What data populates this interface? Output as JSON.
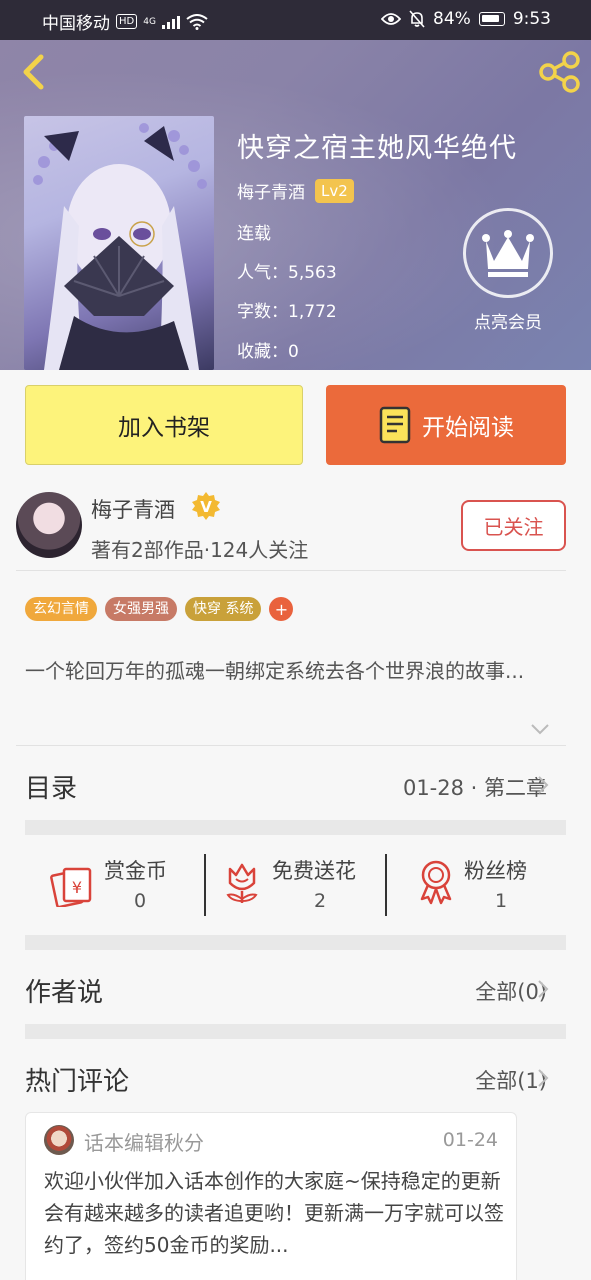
{
  "status_bar": {
    "carrier": "中国移动",
    "hd_badge": "HD",
    "network": "4G",
    "battery": "84%",
    "time": "9:53"
  },
  "book": {
    "title": "快穿之宿主她风华绝代",
    "author": "梅子青酒",
    "author_level": "Lv2",
    "status": "连载",
    "popularity": "人气：5,563",
    "word_count": "字数：1,772",
    "favorites": "收藏：0",
    "vip_label": "点亮会员"
  },
  "actions": {
    "add_shelf": "加入书架",
    "start_reading": "开始阅读"
  },
  "author_card": {
    "name": "梅子青酒",
    "verify_badge": "V",
    "summary": "著有2部作品·124人关注",
    "follow_label": "已关注"
  },
  "tags": [
    {
      "label": "玄幻言情",
      "color": "#f0a83c"
    },
    {
      "label": "女强男强",
      "color": "#c77a66"
    },
    {
      "label": "快穿  系统",
      "color": "#c9a13a"
    }
  ],
  "tag_add": "+",
  "description": "一个轮回万年的孤魂一朝绑定系统去各个世界浪的故事...",
  "catalog": {
    "title": "目录",
    "latest": "01-28 · 第二章"
  },
  "stats": [
    {
      "label": "赏金币",
      "value": "0",
      "icon": "red-envelope-icon"
    },
    {
      "label": "免费送花",
      "value": "2",
      "icon": "flower-icon"
    },
    {
      "label": "粉丝榜",
      "value": "1",
      "icon": "medal-icon"
    }
  ],
  "author_says": {
    "title": "作者说",
    "link": "全部(0)"
  },
  "hot_comments": {
    "title": "热门评论",
    "link": "全部(1)",
    "items": [
      {
        "user": "话本编辑秋分",
        "date": "01-24",
        "text": "欢迎小伙伴加入话本创作的大家庭~保持稳定的更新会有越来越多的读者追更哟！更新满一万字就可以签约了，签约50金币的奖励..."
      }
    ]
  },
  "colors": {
    "accent_orange": "#eb6a3b",
    "shelf_yellow": "#fdf37b",
    "follow_red": "#d9534f",
    "level_gold": "#f3c44e"
  }
}
